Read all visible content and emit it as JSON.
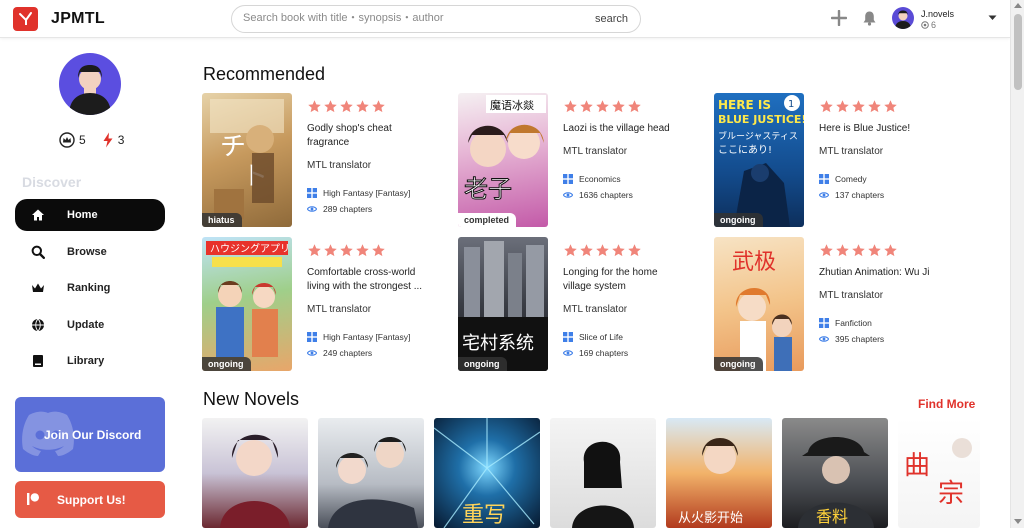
{
  "header": {
    "brand": "JPMTL",
    "search_placeholder": "Search book with title・synopsis・author",
    "search_button": "search",
    "username": "J.novels",
    "points": "6"
  },
  "sidebar": {
    "coins": "5",
    "energy": "3",
    "section_label": "Discover",
    "nav": [
      {
        "label": "Home",
        "icon": "home-icon"
      },
      {
        "label": "Browse",
        "icon": "search-icon"
      },
      {
        "label": "Ranking",
        "icon": "crown-icon"
      },
      {
        "label": "Update",
        "icon": "globe-icon"
      },
      {
        "label": "Library",
        "icon": "book-icon"
      }
    ],
    "discord_label": "Join Our Discord",
    "support_label": "Support Us!"
  },
  "main": {
    "recommended_title": "Recommended",
    "new_novels_title": "New Novels",
    "find_more": "Find More",
    "recommended": [
      {
        "title": "Godly shop's cheat fragrance",
        "translator": "MTL translator",
        "genre": "High Fantasy [Fantasy]",
        "chapters": "289 chapters",
        "status": "hiatus",
        "rating": 5
      },
      {
        "title": "Laozi is the village head",
        "translator": "MTL translator",
        "genre": "Economics",
        "chapters": "1636 chapters",
        "status": "completed",
        "rating": 5
      },
      {
        "title": "Here is Blue Justice!",
        "translator": "MTL translator",
        "genre": "Comedy",
        "chapters": "137 chapters",
        "status": "ongoing",
        "rating": 5
      },
      {
        "title": "Comfortable cross-world living with the strongest ...",
        "translator": "MTL translator",
        "genre": "High Fantasy [Fantasy]",
        "chapters": "249 chapters",
        "status": "ongoing",
        "rating": 5
      },
      {
        "title": "Longing for the home village system",
        "translator": "MTL translator",
        "genre": "Slice of Life",
        "chapters": "169 chapters",
        "status": "ongoing",
        "rating": 5
      },
      {
        "title": "Zhutian Animation: Wu Ji",
        "translator": "MTL translator",
        "genre": "Fanfiction",
        "chapters": "395 chapters",
        "status": "ongoing",
        "rating": 5
      }
    ]
  },
  "colors": {
    "brand_red": "#e0322b",
    "star": "#f0857a",
    "discord": "#5b6fd8",
    "support": "#e65a45",
    "genre_icon": "#3f7fe8",
    "eye_icon": "#3f7fe8"
  }
}
